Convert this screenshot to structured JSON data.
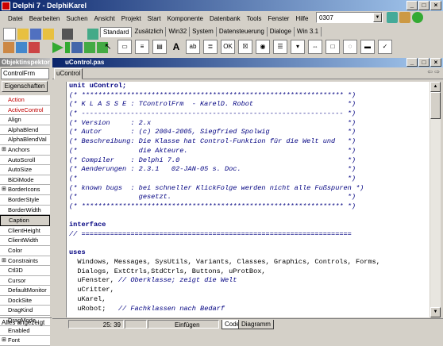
{
  "window": {
    "title": "Delphi 7 - DelphiKarel"
  },
  "menu": [
    "Datei",
    "Bearbeiten",
    "Suchen",
    "Ansicht",
    "Projekt",
    "Start",
    "Komponente",
    "Datenbank",
    "Tools",
    "Fenster",
    "Hilfe"
  ],
  "desktop_combo": {
    "value": "0307"
  },
  "palette_tabs": [
    "Standard",
    "Zusätzlich",
    "Win32",
    "System",
    "Datensteuerung",
    "Dialoge",
    "Win 3.1"
  ],
  "object_inspector": {
    "title": "Objektinspektor",
    "selected_object": "ControlFrm",
    "tab_label": "Eigenschaften",
    "status": "Alles angezeigt",
    "properties": [
      {
        "name": "Action",
        "red": true,
        "plus": false
      },
      {
        "name": "ActiveControl",
        "red": true,
        "plus": false
      },
      {
        "name": "Align",
        "red": false,
        "plus": false
      },
      {
        "name": "AlphaBlend",
        "red": false,
        "plus": false
      },
      {
        "name": "AlphaBlendVal",
        "red": false,
        "plus": false
      },
      {
        "name": "Anchors",
        "red": false,
        "plus": true
      },
      {
        "name": "AutoScroll",
        "red": false,
        "plus": false
      },
      {
        "name": "AutoSize",
        "red": false,
        "plus": false
      },
      {
        "name": "BiDiMode",
        "red": false,
        "plus": false
      },
      {
        "name": "BorderIcons",
        "red": false,
        "plus": true
      },
      {
        "name": "BorderStyle",
        "red": false,
        "plus": false
      },
      {
        "name": "BorderWidth",
        "red": false,
        "plus": false
      },
      {
        "name": "Caption",
        "red": false,
        "plus": false,
        "selected": true
      },
      {
        "name": "ClientHeight",
        "red": false,
        "plus": false
      },
      {
        "name": "ClientWidth",
        "red": false,
        "plus": false
      },
      {
        "name": "Color",
        "red": false,
        "plus": false
      },
      {
        "name": "Constraints",
        "red": false,
        "plus": true
      },
      {
        "name": "Ctl3D",
        "red": false,
        "plus": false
      },
      {
        "name": "Cursor",
        "red": false,
        "plus": false
      },
      {
        "name": "DefaultMonitor",
        "red": false,
        "plus": false
      },
      {
        "name": "DockSite",
        "red": false,
        "plus": false
      },
      {
        "name": "DragKind",
        "red": false,
        "plus": false
      },
      {
        "name": "DragMode",
        "red": false,
        "plus": false
      },
      {
        "name": "Enabled",
        "red": false,
        "plus": false
      },
      {
        "name": "Font",
        "red": false,
        "plus": true
      }
    ]
  },
  "editor": {
    "title": "uControl.pas",
    "tab": "uControl",
    "status_pos": "25: 39",
    "status_mode": "Einfügen",
    "bottom_tabs": [
      "Code",
      "Diagramm"
    ],
    "lines": [
      {
        "t": "unit uControl;",
        "c": "kw"
      },
      {
        "t": "(* **************************************************************** *)",
        "c": "cm"
      },
      {
        "t": "(* K L A S S E : TControlFrm  - KarelD. Robot                       *)",
        "c": "cm"
      },
      {
        "t": "(* ---------------------------------------------------------------- *)",
        "c": "cm"
      },
      {
        "t": "(* Version     : 2.x                                                *)",
        "c": "cm"
      },
      {
        "t": "(* Autor       : (c) 2004-2005, Siegfried Spolwig                   *)",
        "c": "cm"
      },
      {
        "t": "(* Beschreibung: Die Klasse hat Control-Funktion für die Welt und   *)",
        "c": "cm"
      },
      {
        "t": "(*               die Akteure.                                       *)",
        "c": "cm"
      },
      {
        "t": "(* Compiler    : Delphi 7.0                                         *)",
        "c": "cm"
      },
      {
        "t": "(* Aenderungen : 2.3.1   02-JAN-05 s. Doc.                          *)",
        "c": "cm"
      },
      {
        "t": "(*                                                                  *)",
        "c": "cm"
      },
      {
        "t": "(* known bugs  : bei schneller KlickFolge werden nicht alle Fußspuren *)",
        "c": "cm"
      },
      {
        "t": "(*               gesetzt.                                           *)",
        "c": "cm"
      },
      {
        "t": "(* **************************************************************** *)",
        "c": "cm"
      },
      {
        "t": "",
        "c": "plain"
      },
      {
        "t": "interface",
        "c": "kw"
      },
      {
        "t": "// ==================================================================",
        "c": "cm"
      },
      {
        "t": "",
        "c": "plain"
      },
      {
        "t": "uses",
        "c": "kw"
      },
      {
        "t": "  Windows, Messages, SysUtils, Variants, Classes, Graphics, Controls, Forms,",
        "c": "plain"
      },
      {
        "t": "  Dialogs, ExtCtrls,StdCtrls, Buttons, uProtBox,",
        "c": "plain"
      },
      {
        "t": "  uFenster, ",
        "c": "plain",
        "cm": "// Oberklasse; zeigt die Welt"
      },
      {
        "t": "  uCritter,",
        "c": "plain"
      },
      {
        "t": "  uKarel,",
        "c": "plain"
      },
      {
        "t": "  uRobot;   ",
        "c": "plain",
        "cm": "// Fachklassen nach Bedarf"
      }
    ]
  }
}
